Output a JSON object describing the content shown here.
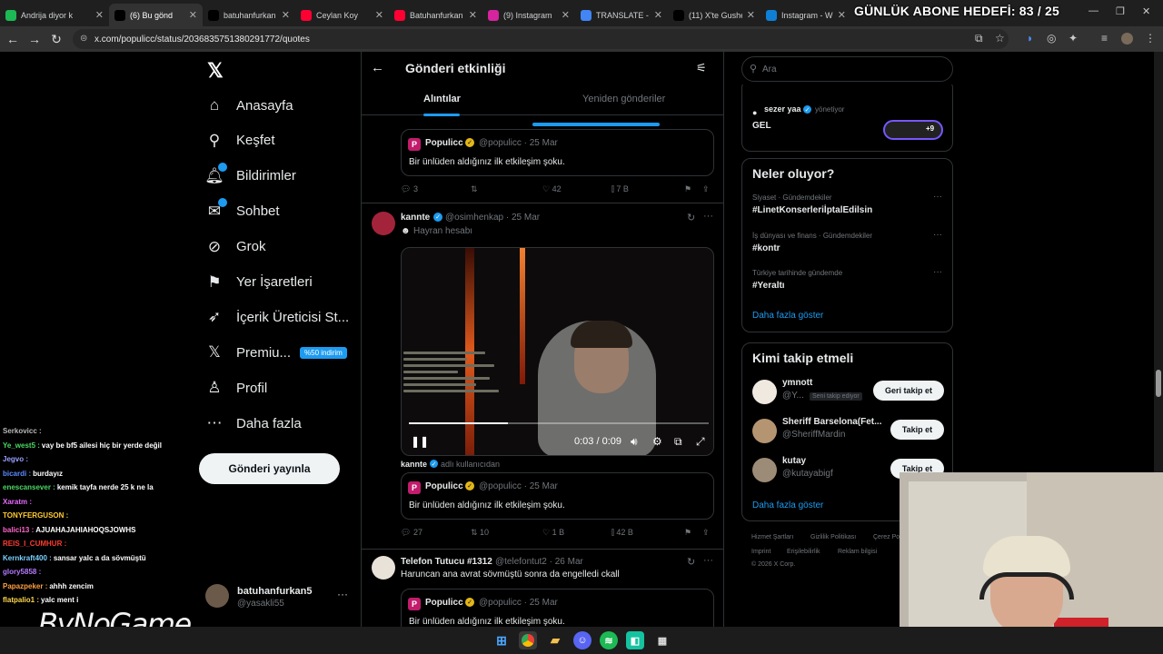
{
  "browser": {
    "tabs": [
      {
        "label": "Andrija diyor k",
        "icon": "green-square-icon",
        "color": "#1db954"
      },
      {
        "label": "(6) Bu gönd",
        "icon": "x-logo-icon",
        "color": "#000000",
        "active": true
      },
      {
        "label": "batuhanfurkan",
        "icon": "tiktok-icon",
        "color": "#000000"
      },
      {
        "label": "Ceylan Koy",
        "icon": "youtube-icon",
        "color": "#ff0033"
      },
      {
        "label": "Batuhanfurkan",
        "icon": "youtube-icon",
        "color": "#ff0033"
      },
      {
        "label": "(9) Instagram",
        "icon": "instagram-icon",
        "color": "#d6249f"
      },
      {
        "label": "TRANSLATE - G",
        "icon": "google-icon",
        "color": "#4285f4"
      },
      {
        "label": "(11) X'te Gushe",
        "icon": "x-logo-icon",
        "color": "#000000"
      },
      {
        "label": "Instagram - W",
        "icon": "edge-icon",
        "color": "#0f7fd6"
      }
    ],
    "goal_overlay": "GÜNLÜK ABONE HEDEFİ: 83 / 25",
    "url": "x.com/populicc/status/2036835751380291772/quotes"
  },
  "nav": {
    "items": [
      {
        "label": "Anasayfa",
        "icon": "home-icon",
        "glyph": "⌂"
      },
      {
        "label": "Keşfet",
        "icon": "search-icon",
        "glyph": "⚲"
      },
      {
        "label": "Bildirimler",
        "icon": "bell-icon",
        "glyph": "🔔︎"
      },
      {
        "label": "Sohbet",
        "icon": "chat-icon",
        "glyph": "✉"
      },
      {
        "label": "Grok",
        "icon": "grok-icon",
        "glyph": "⊘"
      },
      {
        "label": "Yer İşaretleri",
        "icon": "bookmark-icon",
        "glyph": "⚑"
      },
      {
        "label": "İçerik Üreticisi St...",
        "icon": "rocket-icon",
        "glyph": "➶"
      },
      {
        "label": "Premiu...",
        "icon": "x-premium-icon",
        "glyph": "𝕏"
      },
      {
        "label": "Profil",
        "icon": "person-icon",
        "glyph": "♙"
      },
      {
        "label": "Daha fazla",
        "icon": "more-circle-icon",
        "glyph": "⋯"
      }
    ],
    "premium_badge": "%50 indirim",
    "post_button": "Gönderi yayınla",
    "account": {
      "name": "batuhanfurkan5",
      "handle": "@yasakli55",
      "more": "···"
    }
  },
  "center": {
    "title": "Gönderi etkinliği",
    "tabs": [
      "Alıntılar",
      "Yeniden gönderiler"
    ],
    "quoted": {
      "name": "Populicc",
      "handle": "@populicc · 25 Mar",
      "text": "Bir ünlüden aldığınız ilk etkileşim şoku."
    },
    "posts": [
      {
        "actions": {
          "reply": "3",
          "repost": "",
          "like": "42",
          "views": "7 B"
        }
      },
      {
        "name": "kannte",
        "handle": "@osimhenkap · 25 Mar",
        "label": "Hayran hesabı",
        "video": {
          "time": "0:03 / 0:09",
          "progress": 0.33
        },
        "caption_name": "kannte",
        "caption_meta": "adlı kullanıcıdan",
        "actions": {
          "reply": "27",
          "repost": "10",
          "like": "1 B",
          "views": "42 B"
        }
      },
      {
        "name": "Telefon Tutucu #1312",
        "handle": "@telefontut2 · 26 Mar",
        "text": "Haruncan ana avrat sövmüştü sonra da engelledi ckall"
      }
    ]
  },
  "right": {
    "search_placeholder": "Ara",
    "community": {
      "name": "sezer yaa",
      "role": "yönetiyor",
      "title": "GEL",
      "count": "+9"
    },
    "trends_title": "Neler oluyor?",
    "trends": [
      {
        "category": "Siyaset · Gündemdekiler",
        "tag": "#LinetKonserleriİptalEdilsin"
      },
      {
        "category": "İş dünyası ve finans · Gündemdekiler",
        "tag": "#kontr"
      },
      {
        "category": "Türkiye tarihinde gündemde",
        "tag": "#Yeraltı"
      }
    ],
    "show_more": "Daha fazla göster",
    "who_title": "Kimi takip etmeli",
    "who": [
      {
        "name": "ymnott",
        "handle": "@Y...",
        "tag": "Seni takip ediyor",
        "button": "Geri takip et"
      },
      {
        "name": "Sheriff Barselona(Fet...",
        "handle": "@SheriffMardin",
        "button": "Takip et"
      },
      {
        "name": "kutay",
        "handle": "@kutayabigf",
        "button": "Takip et"
      }
    ],
    "footer": [
      "Hizmet Şartları",
      "Gizlilik Politikası",
      "Çerez Po",
      "Imprint",
      "Erişilebilirlik",
      "Reklam bilgisi",
      "© 2026 X Corp."
    ]
  },
  "chat": [
    {
      "user": "Serkovicc",
      "msg": "",
      "color": "#b9b9b9"
    },
    {
      "user": "Ye_west5",
      "msg": "vay be bf5 ailesi hiç bir yerde değil",
      "color": "#4cd964"
    },
    {
      "user": "Jegvo",
      "msg": "",
      "color": "#9aa0ff"
    },
    {
      "user": "bicardi",
      "msg": "burdayız",
      "color": "#5a8cff"
    },
    {
      "user": "enescansever",
      "msg": "kemik tayfa nerde 25 k ne la",
      "color": "#4cd964"
    },
    {
      "user": "Xaratm",
      "msg": "",
      "color": "#e86bff"
    },
    {
      "user": "TONYFERGUSON",
      "msg": "",
      "color": "#ffcc33"
    },
    {
      "user": "balici13",
      "msg": "AJUAHAJAHIAHOQSJOWHS",
      "color": "#ff66cc"
    },
    {
      "user": "REIS_I_CUMHUR",
      "msg": "",
      "color": "#ff3b30"
    },
    {
      "user": "Kernkraft400",
      "msg": "sansar yalc a da sövmüştü",
      "color": "#7ad1ff"
    },
    {
      "user": "glory5858",
      "msg": "",
      "color": "#b57aff"
    },
    {
      "user": "Papazpeker",
      "msg": "ahhh zencim",
      "color": "#ff9f40"
    },
    {
      "user": "flatpalio1",
      "msg": "yalc ment i",
      "color": "#ffd84d"
    }
  ],
  "brand": "ByNoGame"
}
